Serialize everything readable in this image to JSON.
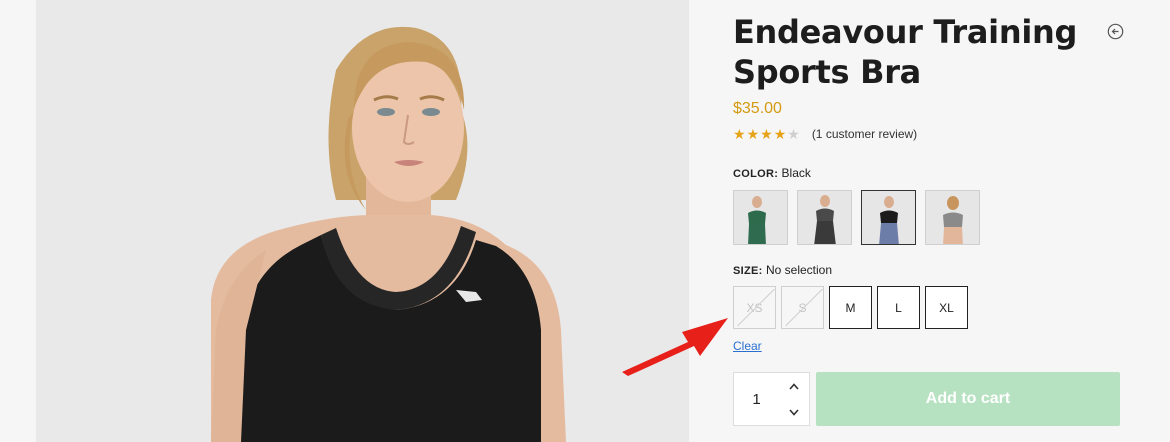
{
  "product": {
    "title": "Endeavour Training Sports Bra",
    "price": "$35.00",
    "rating": {
      "value": 4,
      "max": 5,
      "review_text": "(1 customer review)"
    }
  },
  "icons": {
    "back": "circle-arrow-left-icon",
    "star": "star-icon"
  },
  "color": {
    "label": "COLOR:",
    "selected": "Black",
    "swatches": [
      {
        "name": "green",
        "color": "#2e6b4d"
      },
      {
        "name": "charcoal",
        "color": "#4a4a4a"
      },
      {
        "name": "black",
        "color": "#1c1c1c"
      },
      {
        "name": "grey",
        "color": "#8a8a8a"
      }
    ]
  },
  "size": {
    "label": "SIZE:",
    "selected": "No selection",
    "options": [
      {
        "label": "XS",
        "available": false
      },
      {
        "label": "S",
        "available": false
      },
      {
        "label": "M",
        "available": true
      },
      {
        "label": "L",
        "available": true
      },
      {
        "label": "XL",
        "available": true
      }
    ],
    "clear": "Clear"
  },
  "cart": {
    "quantity": "1",
    "button": "Add to cart"
  },
  "colors": {
    "price": "#d49a10",
    "add_to_cart": "#b7e2c1",
    "link": "#2a6fd0",
    "annotation": "#e8201a"
  }
}
